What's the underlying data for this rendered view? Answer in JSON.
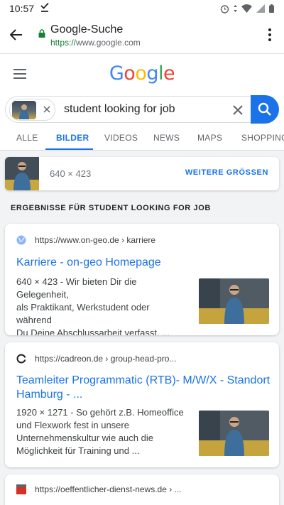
{
  "status_bar": {
    "time": "10:57"
  },
  "browser": {
    "title": "Google-Suche",
    "url_scheme": "https://",
    "url_host": "www.google.com"
  },
  "logo": {
    "text": "Google",
    "colors": [
      "#4285f4",
      "#ea4335",
      "#fbbc05",
      "#4285f4",
      "#34a853",
      "#ea4335"
    ]
  },
  "search": {
    "query": "student looking for job"
  },
  "tabs": [
    {
      "label": "ALLE"
    },
    {
      "label": "BILDER"
    },
    {
      "label": "VIDEOS"
    },
    {
      "label": "NEWS"
    },
    {
      "label": "MAPS"
    },
    {
      "label": "SHOPPING"
    }
  ],
  "preview": {
    "size": "640 × 423",
    "more_label": "WEITERE GRÖSSEN"
  },
  "results_heading": "ERGEBNISSE FÜR STUDENT LOOKING FOR JOB",
  "results": [
    {
      "url": "https://www.on-geo.de › karriere",
      "title_line1": "Karriere - on-geo Homepage",
      "title_line2": "",
      "meta": "640 × 423",
      "snippet_lines": [
        "640 × 423 - Wir bieten Dir die Gelegenheit,",
        "als Praktikant, Werkstudent oder während",
        "Du Deine Abschlussarbeit verfasst, ..."
      ]
    },
    {
      "url": "https://cadreon.de › group-head-pro...",
      "title_line1": "Teamleiter Programmatic (RTB)- M/W/X - Standort",
      "title_line2": "Hamburg - ...",
      "meta": "1920 × 1271",
      "snippet_lines": [
        "1920 × 1271 - So gehört z.B. Homeoffice",
        "und Flexwork fest in unsere",
        "Unternehmenskultur wie auch die",
        "Möglichkeit für Training und ..."
      ]
    },
    {
      "url": "https://oeffentlicher-dienst-news.de › ..."
    }
  ],
  "colors": {
    "accent": "#1a73e8",
    "link": "#1a73e8",
    "secure": "#188038"
  }
}
